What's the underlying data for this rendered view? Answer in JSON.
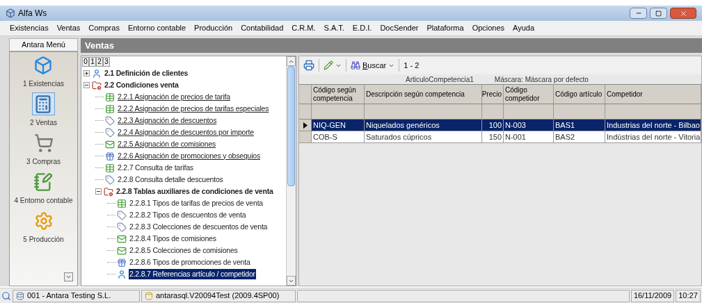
{
  "window": {
    "title": "Alfa Ws"
  },
  "menu_bar": [
    "Existencias",
    "Ventas",
    "Compras",
    "Entorno contable",
    "Producción",
    "Contabilidad",
    "C.R.M.",
    "S.A.T.",
    "E.D.I.",
    "DocSender",
    "Plataforma",
    "Opciones",
    "Ayuda"
  ],
  "side_menu": {
    "title": "Antara Menú",
    "items": [
      {
        "label": "1 Existencias",
        "selected": false
      },
      {
        "label": "2 Ventas",
        "selected": true
      },
      {
        "label": "3 Compras",
        "selected": false
      },
      {
        "label": "4 Entorno contable",
        "selected": false
      },
      {
        "label": "5 Producción",
        "selected": false
      }
    ]
  },
  "panel": {
    "title": "Ventas",
    "level_buttons": [
      "0",
      "1",
      "2",
      "3"
    ],
    "tree": [
      {
        "label": "2.1 Definición de clientes",
        "kind": "group",
        "expanded": false,
        "selected": false
      },
      {
        "label": "2.2 Condiciones venta",
        "kind": "group",
        "expanded": true,
        "selected": false,
        "children": [
          {
            "label": "2.2.1 Asignación de precios de tarifa",
            "kind": "link",
            "selected": false
          },
          {
            "label": "2.2.2 Asignación de precios de tarifas especiales",
            "kind": "link",
            "selected": false
          },
          {
            "label": "2.2.3 Asignación de descuentos",
            "kind": "link",
            "selected": false
          },
          {
            "label": "2.2.4 Asignación de descuentos por importe",
            "kind": "link",
            "selected": false
          },
          {
            "label": "2.2.5 Asignación de comisiones",
            "kind": "link",
            "selected": false
          },
          {
            "label": "2.2.6 Asignación de promociones y obsequios",
            "kind": "link",
            "selected": false
          },
          {
            "label": "2.2.7 Consulta de tarifas",
            "kind": "item",
            "selected": false
          },
          {
            "label": "2.2.8 Consulta detalle descuentos",
            "kind": "item",
            "selected": false
          },
          {
            "label": "2.2.8 Tablas auxiliares de condiciones de venta",
            "kind": "group",
            "expanded": true,
            "selected": false,
            "children": [
              {
                "label": "2.2.8.1 Tipos de tarifas de precios de venta",
                "kind": "item",
                "selected": false
              },
              {
                "label": "2.2.8.2 Tipos de descuentos de venta",
                "kind": "item",
                "selected": false
              },
              {
                "label": "2.2.8.3 Colecciones de descuentos de venta",
                "kind": "item",
                "selected": false
              },
              {
                "label": "2.2.8.4 Tipos de comisiones",
                "kind": "item",
                "selected": false
              },
              {
                "label": "2.2.8.5 Colecciones de comisiones",
                "kind": "item",
                "selected": false
              },
              {
                "label": "2.2.8.6 Tipos de promociones de venta",
                "kind": "item",
                "selected": false
              },
              {
                "label": "2.2.8.7 Referencias artículo / competidor",
                "kind": "item",
                "selected": true
              }
            ]
          }
        ]
      }
    ]
  },
  "grid": {
    "search_label": "Buscar",
    "count": "1 - 2",
    "dataset": "ArticuloCompetencia1",
    "mask": "Máscara: Máscara por defecto",
    "columns": [
      {
        "label": "Código según competencia",
        "kind": "text"
      },
      {
        "label": "Descripción según competencia",
        "kind": "text"
      },
      {
        "label": "Precio",
        "kind": "number"
      },
      {
        "label": "Código competidor",
        "kind": "text"
      },
      {
        "label": "Código artículo",
        "kind": "text"
      },
      {
        "label": "Competidor",
        "kind": "text"
      }
    ],
    "rows": [
      {
        "selected": true,
        "cells": [
          "NIQ-GEN",
          "Niquelados genéricos",
          "100",
          "N-003",
          "BAS1",
          "Industrias del norte - Bilbao"
        ]
      },
      {
        "selected": false,
        "cells": [
          "COB-S",
          "Saturados cúpricos",
          "150",
          "N-001",
          "BAS2",
          "Indústrias del norte - Vitoria"
        ]
      }
    ]
  },
  "status_bar": {
    "company": "001 - Antara Testing S.L.",
    "database": "antarasql.V20094Test (2009.4SP00)",
    "date": "16/11/2009",
    "time": "10:27"
  }
}
